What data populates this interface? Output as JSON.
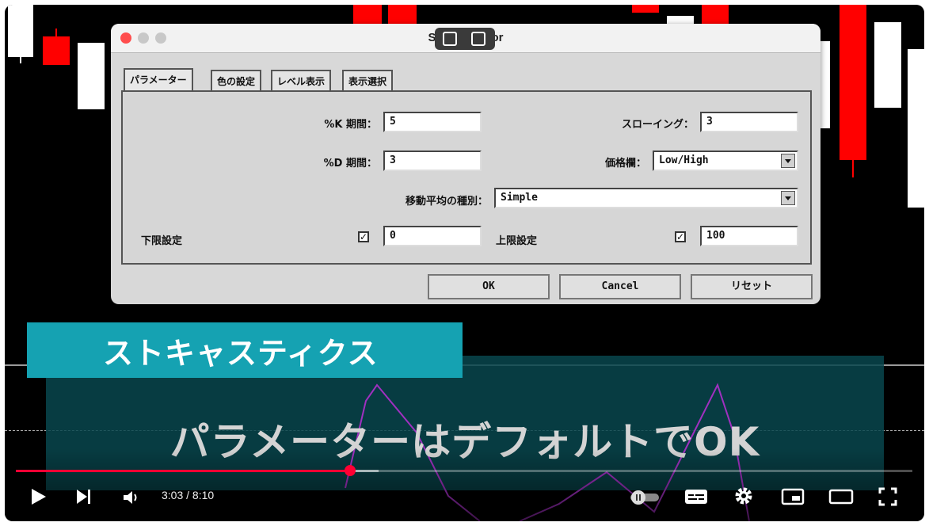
{
  "dialog": {
    "title": "Stoch   cillator",
    "tabs": [
      {
        "label": "パラメーター"
      },
      {
        "label": "色の設定"
      },
      {
        "label": "レベル表示"
      },
      {
        "label": "表示選択"
      }
    ],
    "fields": {
      "k_period_label": "%K 期間：",
      "k_period_value": "5",
      "d_period_label": "%D 期間：",
      "d_period_value": "3",
      "slowing_label": "スローイング：",
      "slowing_value": "3",
      "price_field_label": "価格欄：",
      "price_field_value": "Low/High",
      "ma_method_label": "移動平均の種別：",
      "ma_method_value": "Simple",
      "lower_level_label": "下限設定",
      "lower_level_checked": true,
      "lower_level_value": "0",
      "upper_level_label": "上限設定",
      "upper_level_checked": true,
      "upper_level_value": "100"
    },
    "buttons": {
      "ok": "OK",
      "cancel": "Cancel",
      "reset": "リセット"
    }
  },
  "banner": {
    "label": "ストキャスティクス",
    "subtitle": "パラメーターはデフォルトでOK"
  },
  "player": {
    "time": "3:03 / 8:10",
    "progress_fraction": 0.373,
    "buffer_fraction": 0.405,
    "icons": [
      "play-icon",
      "next-icon",
      "volume-icon",
      "autoplay-toggle-icon",
      "subtitles-icon",
      "settings-gear-icon",
      "miniplayer-icon",
      "theater-mode-icon",
      "fullscreen-icon"
    ]
  },
  "colors": {
    "bear_candle": "#ff0000",
    "bull_candle": "#ffffff",
    "banner_teal": "#15a2b2",
    "progress_red": "#ff0033"
  }
}
